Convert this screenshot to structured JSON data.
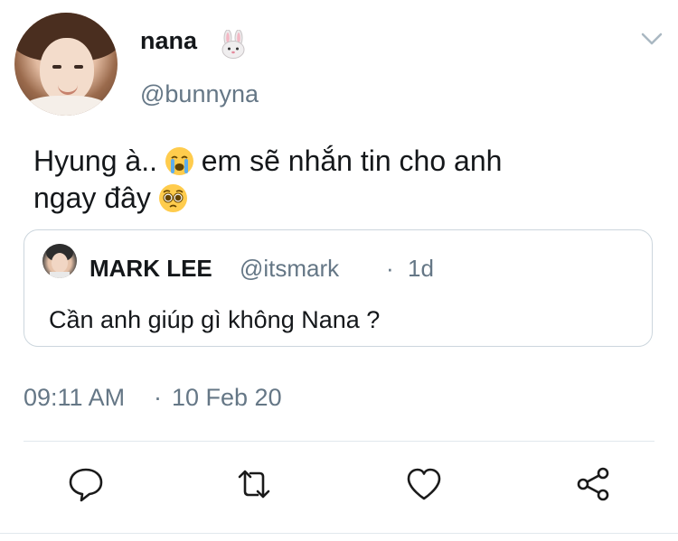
{
  "tweet": {
    "display_name": "nana",
    "handle": "@bunnyna",
    "text_part1": "Hyung à..",
    "text_part2": "em sẽ nhắn tin cho anh",
    "text_part3": "ngay đây",
    "timestamp": "09:11 AM",
    "separator": "·",
    "date": "10 Feb 20"
  },
  "quoted_tweet": {
    "display_name": "MARK LEE",
    "handle": "@itsmark",
    "separator": "·",
    "time": "1d",
    "text": "Cần anh giúp gì không Nana ?"
  },
  "icons": {
    "name_emoji": "rabbit-face-icon",
    "emoji_1": "loudly-crying-face-icon",
    "emoji_2": "pleading-face-icon",
    "menu": "chevron-down-icon",
    "actions": [
      "reply-icon",
      "retweet-icon",
      "like-icon",
      "share-icon"
    ]
  },
  "colors": {
    "text_primary": "#14171a",
    "text_secondary": "#657786",
    "border": "#ccd6dd",
    "icon": "#1a1a1a"
  }
}
